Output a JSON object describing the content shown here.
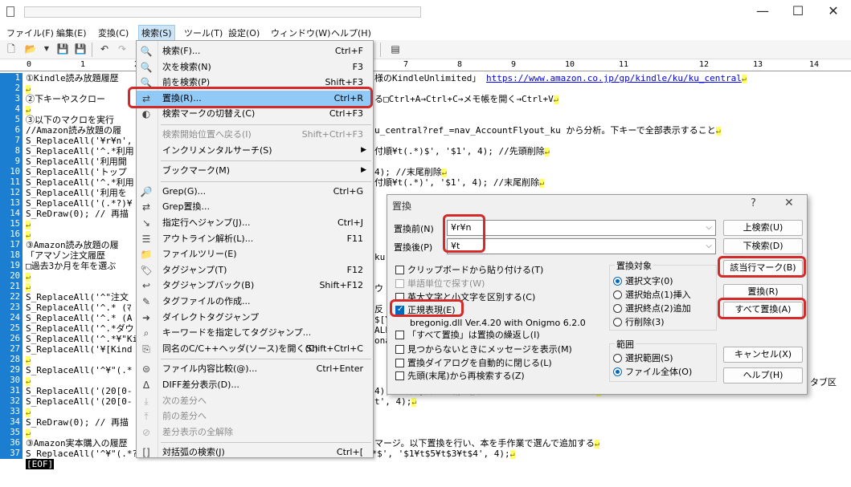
{
  "window": {
    "minimize": "—",
    "maximize": "☐",
    "close": "✕"
  },
  "menubar": [
    "ファイル(F)",
    "編集(E)",
    "変換(C)",
    "検索(S)",
    "ツール(T)",
    "設定(O)",
    "ウィンドウ(W)",
    "ヘルプ(H)"
  ],
  "ruler": [
    "0",
    "1",
    "2",
    "3",
    "4",
    "5",
    "6",
    "7",
    "8",
    "9",
    "10",
    "11",
    "12",
    "13",
    "14"
  ],
  "editor": {
    "lines": [
      {
        "n": "1",
        "t": "①Kindle読み放題履歴",
        "t2": "様のKindleUnlimited」 ",
        "link": "https://www.amazon.co.jp/gp/kindle/ku/ku_central",
        "ret": "↵"
      },
      {
        "n": "2",
        "t": "",
        "ret": "↵"
      },
      {
        "n": "3",
        "t": "②下キーやスクロー",
        "t2": "る□Ctrl+A→Ctrl+C→メモ帳を開く→Ctrl+V",
        "ret": "↵"
      },
      {
        "n": "4",
        "t": "",
        "ret": "↵"
      },
      {
        "n": "5",
        "t": "③以下のマクロを実行",
        "ret": ""
      },
      {
        "n": "6",
        "t": "//Amazon読み放題の履",
        "t2": "u_central?ref_=nav_AccountFlyout_ku から分析。下キーで全部表示すること",
        "ret": "↵"
      },
      {
        "n": "7",
        "t": "S_ReplaceAll('¥r¥n',",
        "ret": ""
      },
      {
        "n": "8",
        "t": "S_ReplaceAll('^.*利用",
        "t2": "付順¥t(.*)$', '$1', 4); //先頭削除",
        "ret": "↵"
      },
      {
        "n": "9",
        "t": "S_ReplaceAll('利用開",
        "ret": ""
      },
      {
        "n": "10",
        "t": "S_ReplaceAll('トップ",
        "t2": "4); //末尾削除",
        "ret": "↵"
      },
      {
        "n": "11",
        "t": "S_ReplaceAll('^.*利用",
        "t2": "付順¥t(.*)', '$1', 4); //末尾削除",
        "ret": "↵"
      },
      {
        "n": "12",
        "t": "S_ReplaceAll('利用を",
        "ret": ""
      },
      {
        "n": "13",
        "t": "S_ReplaceAll('(.*?)¥",
        "ret": ""
      },
      {
        "n": "14",
        "t": "S_ReDraw(0); // 再描",
        "ret": ""
      },
      {
        "n": "15",
        "t": "",
        "ret": "↵"
      },
      {
        "n": "16",
        "t": "",
        "ret": "↵"
      },
      {
        "n": "17",
        "t": "③Amazon読み放題の履",
        "ret": ""
      },
      {
        "n": "18",
        "t": "「アマゾン注文履歴",
        "ret": ""
      },
      {
        "n": "19",
        "t": "□過去3か月を年を選ぶ",
        "ret": ""
      },
      {
        "n": "20",
        "t": "",
        "ret": "↵"
      },
      {
        "n": "21",
        "t": "",
        "ret": "↵"
      },
      {
        "n": "22",
        "t": "S_ReplaceAll('^\"注文",
        "ret": ""
      },
      {
        "n": "23",
        "t": "S_ReplaceAll('^.* (ﾏ",
        "ret": ""
      },
      {
        "n": "24",
        "t": "S_ReplaceAll('^.* (A",
        "ret": ""
      },
      {
        "n": "25",
        "t": "S_ReplaceAll('^.*ダウ",
        "ret": ""
      },
      {
        "n": "26",
        "t": "S_ReplaceAll('^.*¥\"Ki",
        "ret": ""
      },
      {
        "n": "27",
        "t": "S_ReplaceAll('¥[Kind",
        "ret": ""
      },
      {
        "n": "28",
        "t": "",
        "ret": "↵"
      },
      {
        "n": "29",
        "t": "S_ReplaceAll('^¥\"(.*",
        "ret": ""
      },
      {
        "n": "30",
        "t": "",
        "ret": "↵"
      },
      {
        "n": "31",
        "t": "S_ReplaceAll('(20[0-",
        "t2": "4); //年月日の10桁置換 2023/2/4 → 2023/02/04",
        "ret": "↵"
      },
      {
        "n": "32",
        "t": "S_ReplaceAll('(20[0-",
        "t2": "t', 4);",
        "ret": "↵"
      },
      {
        "n": "33",
        "t": "",
        "ret": "↵"
      },
      {
        "n": "34",
        "t": "S_ReDraw(0); // 再描",
        "ret": ""
      },
      {
        "n": "35",
        "t": "",
        "ret": "↵"
      },
      {
        "n": "36",
        "t": "③Amazon実本購入の履歴",
        "t2": "マージ。以下置換を行い、本を手作業で選んで追加する",
        "ret": "↵"
      },
      {
        "n": "37",
        "t": "S_ReplaceAll('^¥\"(.*?)¥\",¥\"(.*?)¥\",¥\"(.*?)¥\",¥\"(.*?)¥\",([0-9]+),.*$', '$1¥t$5¥t$3¥t$4', 4);",
        "ret": "↵"
      }
    ],
    "eof": "[EOF]",
    "fragments": {
      "r17": "ku",
      "r22": "ウ",
      "r24": "反",
      "r25": "$[Y",
      "r26": "ALL",
      "r27": "ona",
      "r29": "タブ区"
    }
  },
  "search_menu": {
    "items": [
      {
        "label": "検索(F)...",
        "shortcut": "Ctrl+F",
        "icon": "find-icon",
        "state": "normal"
      },
      {
        "label": "次を検索(N)",
        "shortcut": "F3",
        "icon": "find-next-icon",
        "state": "normal"
      },
      {
        "label": "前を検索(P)",
        "shortcut": "Shift+F3",
        "icon": "find-prev-icon",
        "state": "normal"
      },
      {
        "label": "置換(R)...",
        "shortcut": "Ctrl+R",
        "icon": "replace-icon",
        "state": "highlight"
      },
      {
        "label": "検索マークの切替え(C)",
        "shortcut": "Ctrl+F3",
        "icon": "mark-toggle-icon",
        "state": "normal"
      },
      {
        "label": "検索開始位置へ戻る(I)",
        "shortcut": "Shift+Ctrl+F3",
        "icon": "",
        "state": "disabled"
      },
      {
        "label": "インクリメンタルサーチ(S)",
        "shortcut": "",
        "icon": "",
        "state": "submenu"
      },
      {
        "label": "ブックマーク(M)",
        "shortcut": "",
        "icon": "",
        "state": "submenu"
      },
      {
        "label": "Grep(G)...",
        "shortcut": "Ctrl+G",
        "icon": "grep-icon",
        "state": "normal"
      },
      {
        "label": "Grep置換...",
        "shortcut": "",
        "icon": "grep-replace-icon",
        "state": "normal"
      },
      {
        "label": "指定行へジャンプ(J)...",
        "shortcut": "Ctrl+J",
        "icon": "jump-icon",
        "state": "normal"
      },
      {
        "label": "アウトライン解析(L)...",
        "shortcut": "F11",
        "icon": "outline-icon",
        "state": "normal"
      },
      {
        "label": "ファイルツリー(E)",
        "shortcut": "",
        "icon": "folder-icon",
        "state": "normal"
      },
      {
        "label": "タグジャンプ(T)",
        "shortcut": "F12",
        "icon": "tag-jump-icon",
        "state": "normal"
      },
      {
        "label": "タグジャンプバック(B)",
        "shortcut": "Shift+F12",
        "icon": "tag-back-icon",
        "state": "normal"
      },
      {
        "label": "タグファイルの作成...",
        "shortcut": "",
        "icon": "tag-make-icon",
        "state": "normal"
      },
      {
        "label": "ダイレクトタグジャンプ",
        "shortcut": "",
        "icon": "direct-tag-icon",
        "state": "normal"
      },
      {
        "label": "キーワードを指定してタグジャンプ...",
        "shortcut": "",
        "icon": "keyword-tag-icon",
        "state": "normal"
      },
      {
        "label": "同名のC/C++ヘッダ(ソース)を開く(C)",
        "shortcut": "Shift+Ctrl+C",
        "icon": "header-icon",
        "state": "normal"
      },
      {
        "label": "ファイル内容比較(@)...",
        "shortcut": "Ctrl+Enter",
        "icon": "compare-icon",
        "state": "normal"
      },
      {
        "label": "DIFF差分表示(D)...",
        "shortcut": "",
        "icon": "diff-icon",
        "state": "normal"
      },
      {
        "label": "次の差分へ",
        "shortcut": "",
        "icon": "diff-next-icon",
        "state": "disabled"
      },
      {
        "label": "前の差分へ",
        "shortcut": "",
        "icon": "diff-prev-icon",
        "state": "disabled"
      },
      {
        "label": "差分表示の全解除",
        "shortcut": "",
        "icon": "diff-clear-icon",
        "state": "disabled"
      },
      {
        "label": "対括弧の検索(J)",
        "shortcut": "Ctrl+[",
        "icon": "bracket-icon",
        "state": "normal"
      }
    ]
  },
  "dialog": {
    "title": "置換",
    "help_glyph": "?",
    "close_glyph": "✕",
    "before_label": "置換前(N)",
    "before_value": "¥r¥n",
    "after_label": "置換後(P)",
    "after_value": "¥t",
    "buttons": {
      "up": "上検索(U)",
      "down": "下検索(D)",
      "mark": "該当行マーク(B)",
      "replace": "置換(R)",
      "replace_all": "すべて置換(A)",
      "cancel": "キャンセル(X)",
      "help": "ヘルプ(H)"
    },
    "options": [
      {
        "label": "クリップボードから貼り付ける(T)",
        "checked": false,
        "disabled": false
      },
      {
        "label": "単語単位で探す(W)",
        "checked": false,
        "disabled": true
      },
      {
        "label": "英大文字と小文字を区別する(C)",
        "checked": false,
        "disabled": false
      },
      {
        "label": "正規表現(E)",
        "checked": true,
        "disabled": false
      }
    ],
    "regex_lib": "bregonig.dll Ver.4.20 with Onigmo 6.2.0",
    "options2": [
      {
        "label": "「すべて置換」は置換の繰返し(I)",
        "checked": false
      },
      {
        "label": "見つからないときにメッセージを表示(M)",
        "checked": false
      },
      {
        "label": "置換ダイアログを自動的に閉じる(L)",
        "checked": false
      },
      {
        "label": "先頭(末尾)から再検索する(Z)",
        "checked": false
      }
    ],
    "target_group": {
      "title": "置換対象",
      "items": [
        {
          "label": "選択文字(0)",
          "selected": true
        },
        {
          "label": "選択始点(1)挿入",
          "selected": false
        },
        {
          "label": "選択終点(2)追加",
          "selected": false
        },
        {
          "label": "行削除(3)",
          "selected": false
        }
      ]
    },
    "range_group": {
      "title": "範囲",
      "items": [
        {
          "label": "選択範囲(S)",
          "selected": false
        },
        {
          "label": "ファイル全体(O)",
          "selected": true
        }
      ]
    }
  },
  "colors": {
    "highlight_outline": "#d42a2a",
    "menu_highlight": "#91c9f7",
    "gutter": "#1c7ed0",
    "checked": "#0067c0"
  }
}
